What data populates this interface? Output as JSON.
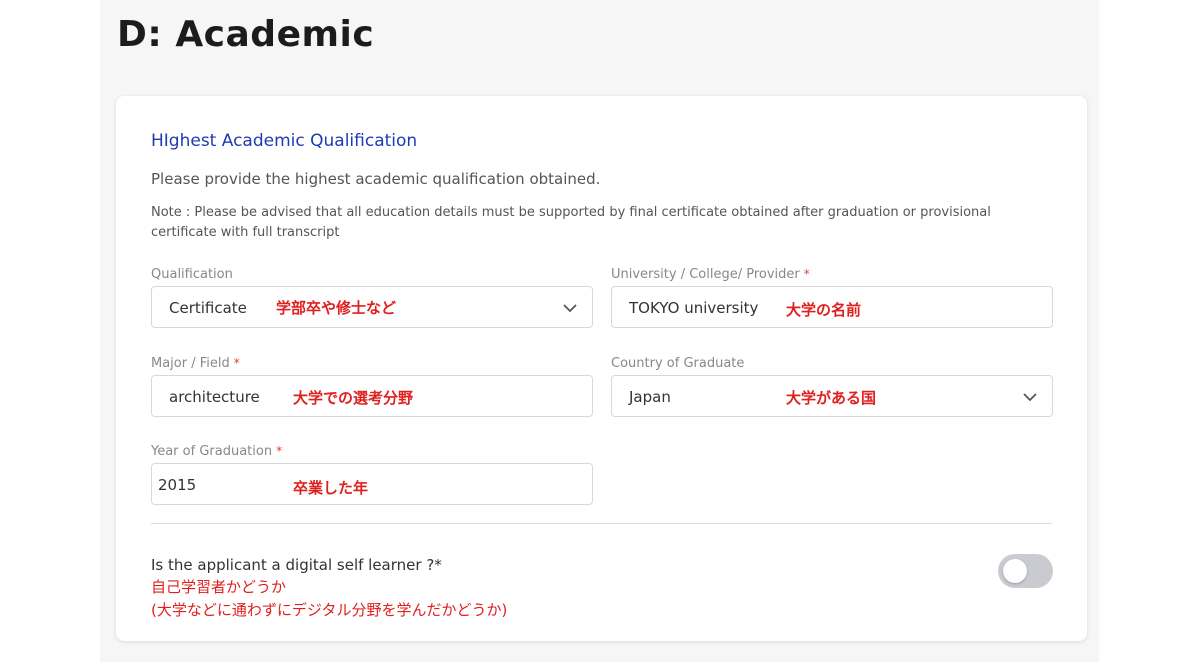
{
  "page": {
    "title": "D: Academic"
  },
  "section": {
    "title": "HIghest Academic Qualification",
    "description": "Please provide the highest academic qualification obtained.",
    "note": "Note : Please be advised that all education details must be supported by final certificate obtained after graduation or provisional certificate with full transcript"
  },
  "fields": {
    "qualification": {
      "label": "Qualification",
      "value": "Certificate",
      "annotation": "学部卒や修士など"
    },
    "university": {
      "label": "University / College/ Provider",
      "required": "*",
      "value": "TOKYO university",
      "annotation": "大学の名前"
    },
    "major": {
      "label": "Major / Field",
      "required": "*",
      "value": "architecture",
      "annotation": "大学での選考分野"
    },
    "country": {
      "label": "Country of Graduate",
      "value": "Japan",
      "annotation": "大学がある国"
    },
    "year": {
      "label": "Year of Graduation",
      "required": "*",
      "value": "2015",
      "annotation": "卒業した年"
    }
  },
  "self_learner": {
    "question": "Is the applicant a digital self learner ?*",
    "annotation_line1": "自己学習者かどうか",
    "annotation_line2": "(大学などに通わずにデジタル分野を学んだかどうか)",
    "enabled": false
  },
  "colors": {
    "title_blue": "#1f3bb3",
    "annotation_red": "#e0201f",
    "required_red": "#e53935",
    "toggle_off": "#c9cbd1"
  }
}
